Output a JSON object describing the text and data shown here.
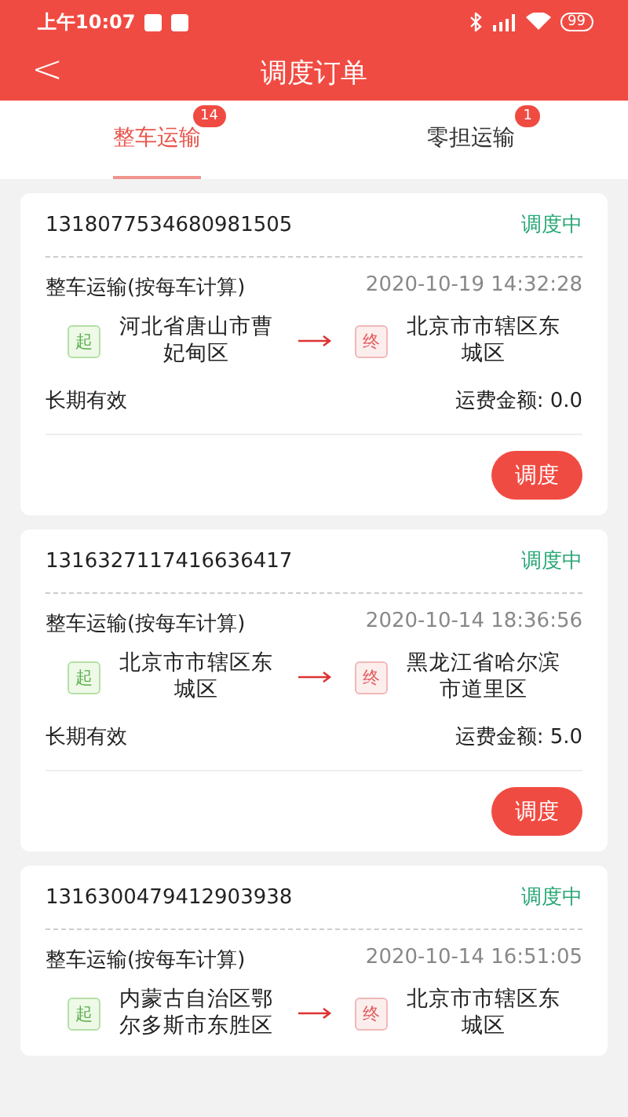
{
  "status_bar": {
    "time": "上午10:07",
    "battery": "99"
  },
  "header": {
    "back": "<",
    "title": "调度订单"
  },
  "tabs": [
    {
      "label": "整车运输",
      "badge": "14",
      "selected": true
    },
    {
      "label": "零担运输",
      "badge": "1",
      "selected": false
    }
  ],
  "orders": [
    {
      "number": "1318077534680981505",
      "status": "调度中",
      "type": "整车运输(按每车计算)",
      "time": "2020-10-19 14:32:28",
      "start_tag": "起",
      "from": "河北省唐山市曹妃甸区",
      "end_tag": "终",
      "to": "北京市市辖区东城区",
      "validity": "长期有效",
      "fee": "运费金额: 0.0",
      "action": "调度"
    },
    {
      "number": "1316327117416636417",
      "status": "调度中",
      "type": "整车运输(按每车计算)",
      "time": "2020-10-14 18:36:56",
      "start_tag": "起",
      "from": "北京市市辖区东城区",
      "end_tag": "终",
      "to": "黑龙江省哈尔滨市道里区",
      "validity": "长期有效",
      "fee": "运费金额: 5.0",
      "action": "调度"
    },
    {
      "number": "1316300479412903938",
      "status": "调度中",
      "type": "整车运输(按每车计算)",
      "time": "2020-10-14 16:51:05",
      "start_tag": "起",
      "from": "内蒙古自治区鄂尔多斯市东胜区",
      "end_tag": "终",
      "to": "北京市市辖区东城区"
    }
  ]
}
